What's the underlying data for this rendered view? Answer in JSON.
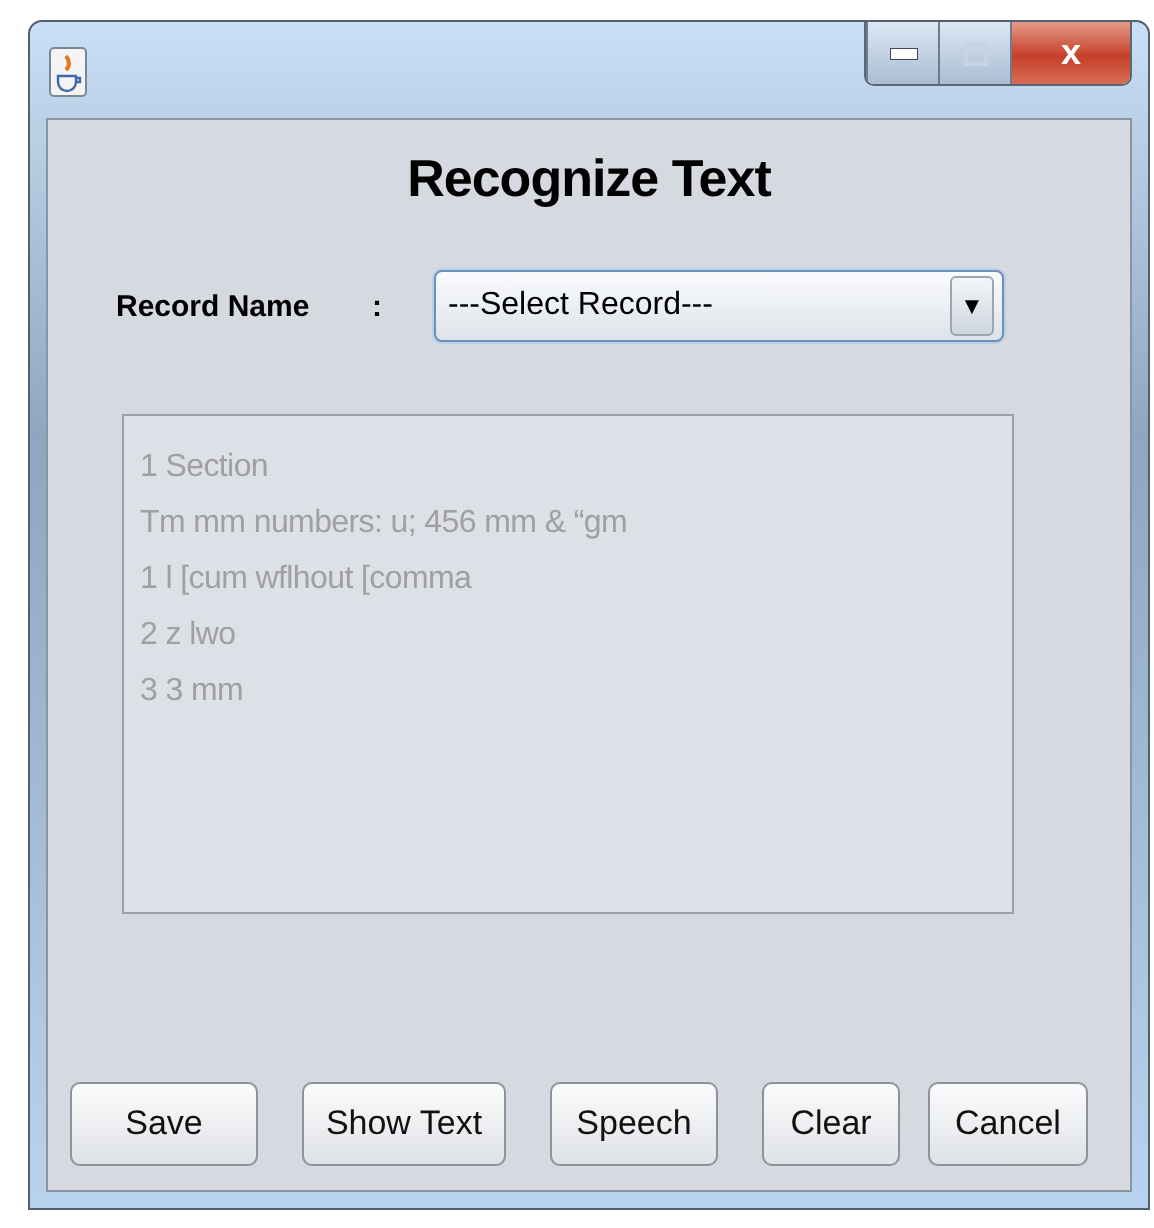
{
  "window": {
    "title_buttons": [
      "x"
    ]
  },
  "heading": "Recognize Text",
  "record": {
    "label": "Record Name",
    "separator": ":",
    "value": "---Select Record---",
    "arrow": "▼"
  },
  "text_area": {
    "lines": [
      "1 Section",
      "Tm mm numbers: u; 456 mm & “gm",
      "1 l [cum wflhout [comma",
      "2 z lwo",
      "3 3 mm"
    ]
  },
  "buttons": [
    "Save",
    "Show Text",
    "Speech",
    "Clear",
    "Cancel"
  ]
}
